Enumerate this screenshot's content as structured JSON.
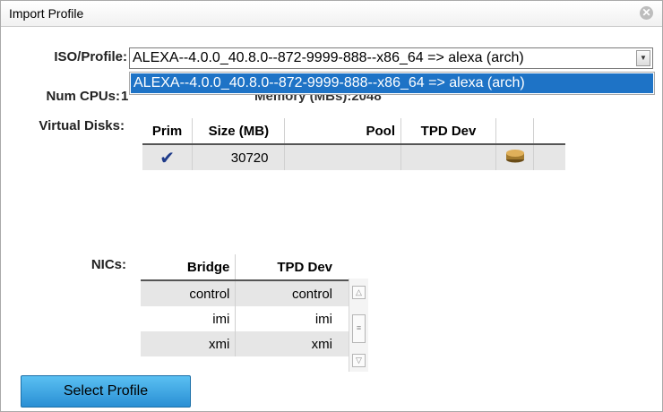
{
  "window": {
    "title": "Import Profile",
    "close_glyph": "✕"
  },
  "iso_profile": {
    "label": "ISO/Profile:",
    "selected_value": "ALEXA--4.0.0_40.8.0--872-9999-888--x86_64 => alexa (arch)",
    "options": [
      "ALEXA--4.0.0_40.8.0--872-9999-888--x86_64 => alexa (arch)"
    ]
  },
  "num_cpus": {
    "label": "Num CPUs:",
    "value": "1"
  },
  "memory": {
    "text": "Memory (MBs):2048"
  },
  "virtual_disks": {
    "label": "Virtual Disks:",
    "columns": [
      "Prim",
      "Size (MB)",
      "Pool",
      "TPD Dev"
    ],
    "rows": [
      {
        "prim_mark": "✔",
        "size": "30720",
        "pool": "",
        "tpd_dev": ""
      }
    ]
  },
  "nics": {
    "label": "NICs:",
    "columns": [
      "Bridge",
      "TPD Dev"
    ],
    "rows": [
      {
        "bridge": "control",
        "tpd_dev": "control"
      },
      {
        "bridge": "imi",
        "tpd_dev": "imi"
      },
      {
        "bridge": "xmi",
        "tpd_dev": "xmi"
      }
    ]
  },
  "actions": {
    "select_profile": "Select Profile"
  }
}
